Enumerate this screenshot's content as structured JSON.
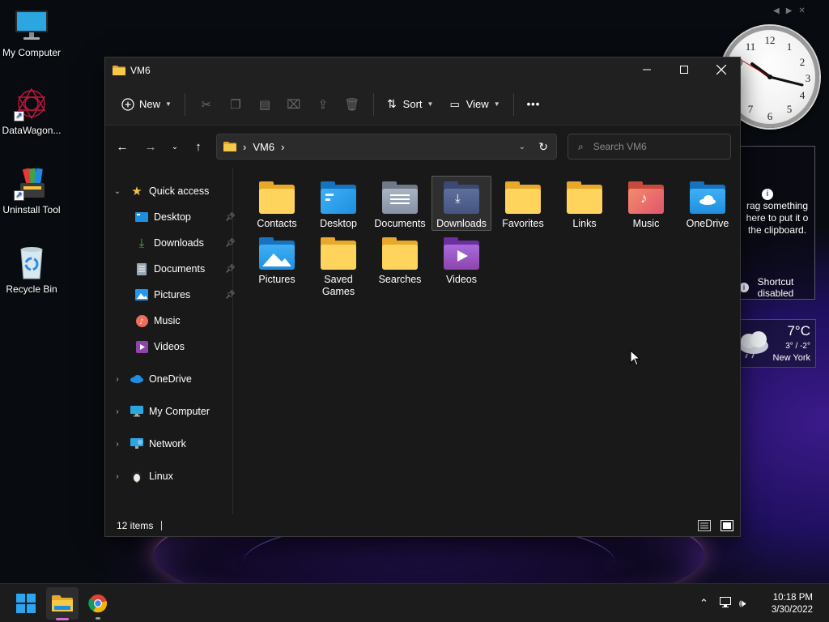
{
  "desktop": {
    "icons": [
      {
        "label": "My Computer"
      },
      {
        "label": "DataWagon..."
      },
      {
        "label": "Uninstall Tool"
      },
      {
        "label": "Recycle Bin"
      }
    ],
    "clipboard_gadget": {
      "hint": "rag something here to put it o the clipboard.",
      "shortcut": "Shortcut disabled"
    },
    "weather_gadget": {
      "temp": "7°C",
      "range": "3° / -2°",
      "city": "New York"
    }
  },
  "window": {
    "title": "VM6",
    "toolbar": {
      "new_label": "New",
      "sort_label": "Sort",
      "view_label": "View",
      "more_label": "•••"
    },
    "address": {
      "segments": [
        "VM6"
      ]
    },
    "search": {
      "placeholder": "Search VM6"
    },
    "sidebar": {
      "quick_access": "Quick access",
      "pinned": [
        {
          "label": "Desktop"
        },
        {
          "label": "Downloads"
        },
        {
          "label": "Documents"
        },
        {
          "label": "Pictures"
        },
        {
          "label": "Music"
        },
        {
          "label": "Videos"
        }
      ],
      "roots": [
        {
          "label": "OneDrive"
        },
        {
          "label": "My Computer"
        },
        {
          "label": "Network"
        },
        {
          "label": "Linux"
        }
      ]
    },
    "items": [
      {
        "label": "Contacts",
        "icon": "folder-contacts-icon"
      },
      {
        "label": "Desktop",
        "icon": "folder-desktop-icon"
      },
      {
        "label": "Documents",
        "icon": "folder-documents-icon"
      },
      {
        "label": "Downloads",
        "icon": "folder-downloads-icon",
        "selected": true
      },
      {
        "label": "Favorites",
        "icon": "folder-favorites-icon"
      },
      {
        "label": "Links",
        "icon": "folder-links-icon"
      },
      {
        "label": "Music",
        "icon": "folder-music-icon"
      },
      {
        "label": "OneDrive",
        "icon": "folder-onedrive-icon"
      },
      {
        "label": "Pictures",
        "icon": "folder-pictures-icon"
      },
      {
        "label": "Saved Games",
        "icon": "folder-savedgames-icon"
      },
      {
        "label": "Searches",
        "icon": "folder-searches-icon"
      },
      {
        "label": "Videos",
        "icon": "folder-videos-icon"
      }
    ],
    "status": {
      "count": "12 items"
    }
  },
  "taskbar": {
    "time": "10:18 PM",
    "date": "3/30/2022"
  },
  "colors": {
    "folder_yellow": "#f5c542",
    "folder_blue": "#1e8fe0",
    "accent_pink": "#d36ad6"
  }
}
